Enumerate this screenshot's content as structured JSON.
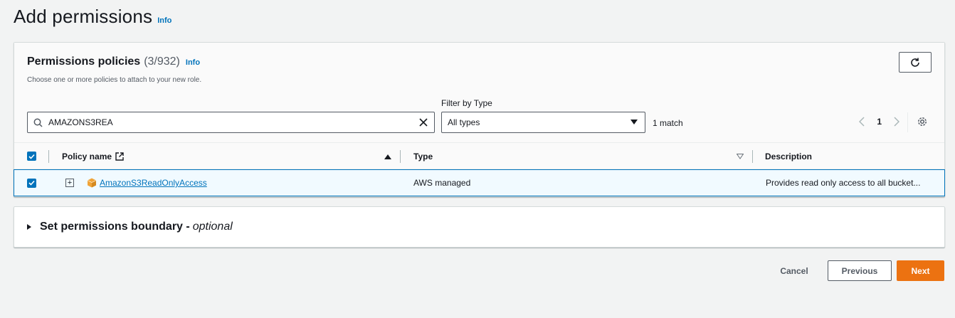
{
  "page": {
    "title": "Add permissions",
    "info": "Info"
  },
  "policies": {
    "title": "Permissions policies",
    "count": "(3/932)",
    "info": "Info",
    "description": "Choose one or more policies to attach to your new role.",
    "search_value": "AMAZONS3REA",
    "filter_label": "Filter by Type",
    "filter_value": "All types",
    "match_count": "1 match",
    "page_number": "1",
    "columns": {
      "policy_name": "Policy name",
      "type": "Type",
      "description": "Description"
    },
    "rows": [
      {
        "policy_name": "AmazonS3ReadOnlyAccess",
        "type": "AWS managed",
        "description": "Provides read only access to all bucket..."
      }
    ]
  },
  "boundary": {
    "title": "Set permissions boundary -",
    "optional": "optional"
  },
  "footer": {
    "cancel": "Cancel",
    "previous": "Previous",
    "next": "Next"
  },
  "colors": {
    "accent": "#0073bb",
    "primary_button": "#ec7211"
  }
}
